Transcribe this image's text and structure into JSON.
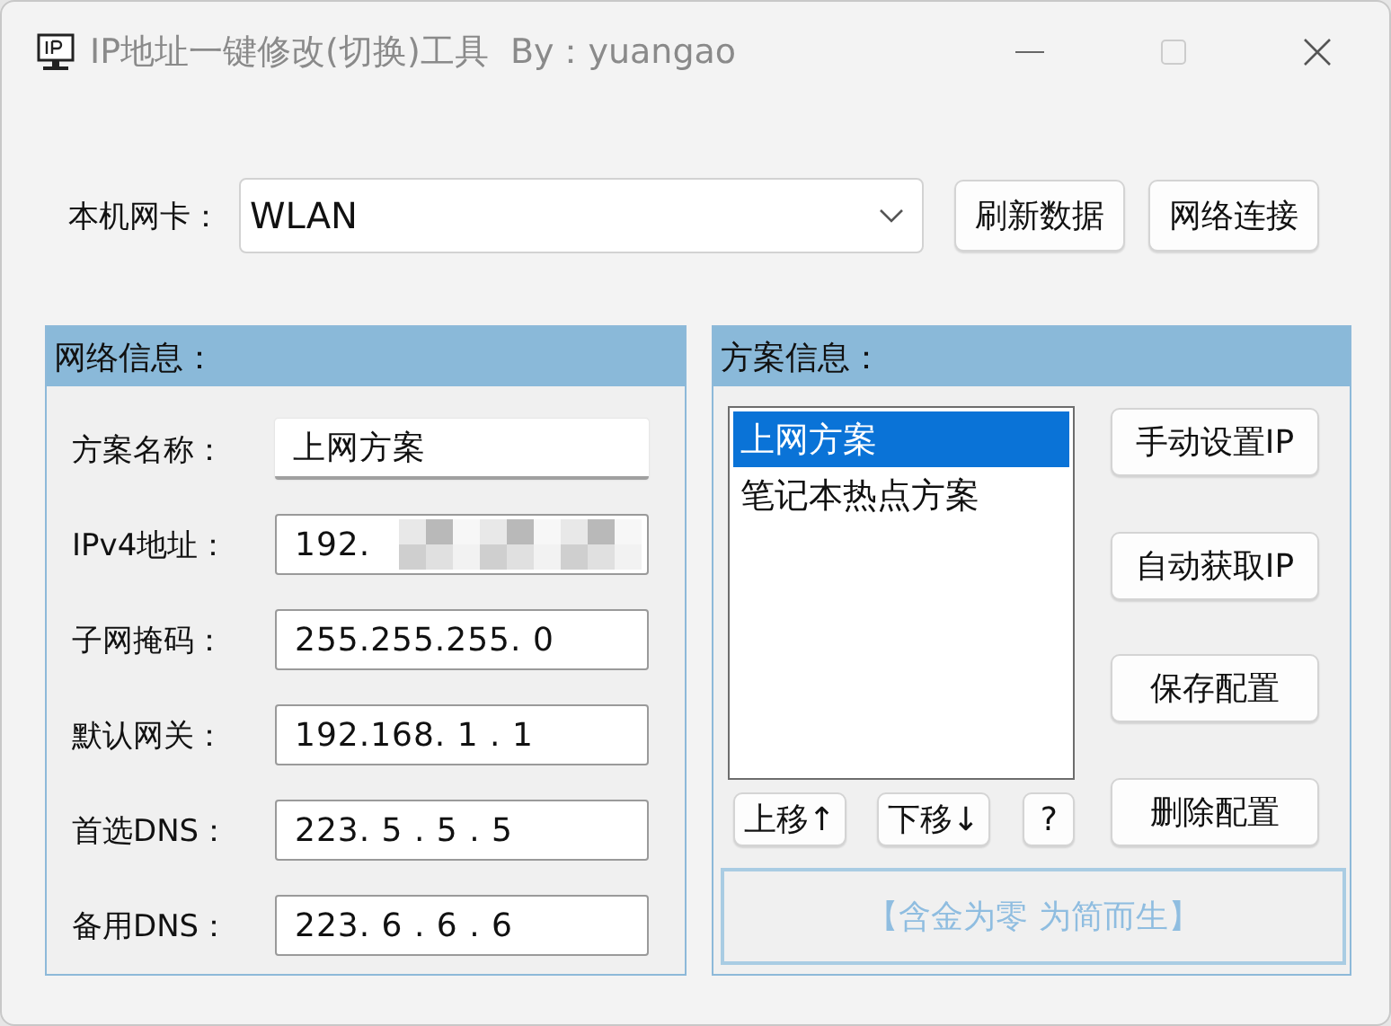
{
  "window": {
    "title": "IP地址一键修改(切换)工具  By：yuangao"
  },
  "adapter": {
    "label": "本机网卡：",
    "value": "WLAN"
  },
  "top_buttons": [
    "刷新数据",
    "网络连接"
  ],
  "network_info": {
    "title": "网络信息：",
    "fields": [
      {
        "label": "方案名称：",
        "value": "上网方案",
        "redacted": false
      },
      {
        "label": "IPv4地址：",
        "value": "192.",
        "redacted": true
      },
      {
        "label": "子网掩码：",
        "value": "255.255.255. 0",
        "redacted": false
      },
      {
        "label": "默认网关：",
        "value": "192.168. 1 . 1",
        "redacted": false
      },
      {
        "label": "首选DNS：",
        "value": "223. 5 . 5 . 5",
        "redacted": false
      },
      {
        "label": "备用DNS：",
        "value": "223. 6 . 6 . 6",
        "redacted": false
      }
    ]
  },
  "plan_info": {
    "title": "方案信息：",
    "plans": [
      {
        "label": "上网方案",
        "selected": true
      },
      {
        "label": "笔记本热点方案",
        "selected": false
      }
    ],
    "move_buttons": [
      "上移↑",
      "下移↓",
      "?"
    ],
    "action_buttons": [
      "手动设置IP",
      "自动获取IP",
      "保存配置",
      "删除配置"
    ],
    "slogan": "【含金为零 为简而生】"
  }
}
